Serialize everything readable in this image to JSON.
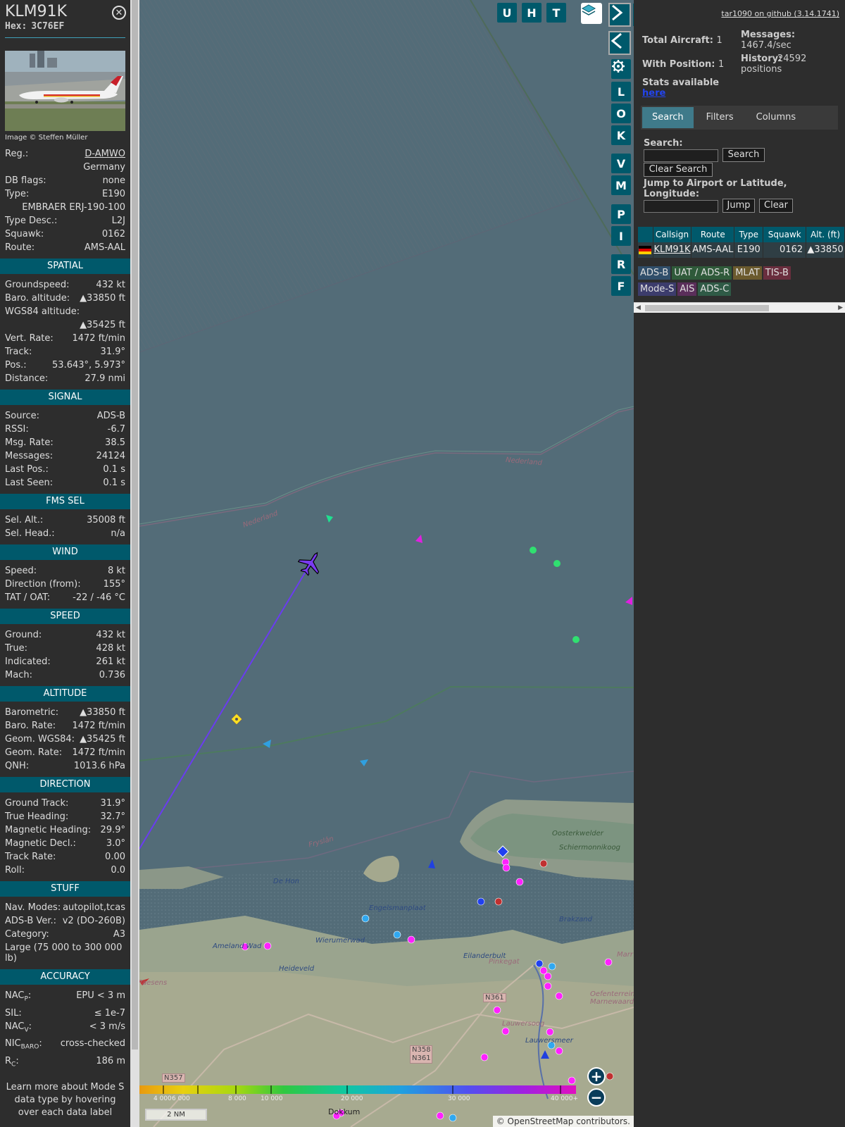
{
  "aircraft": {
    "callsign": "KLM91K",
    "hex_label": "Hex:",
    "hex": "3C76EF",
    "photo_credit": "Image © Steffen Müller"
  },
  "info": [
    {
      "label": "Reg.:",
      "value": "D-AMWO",
      "link": true
    },
    {
      "label": "",
      "value": "Germany"
    },
    {
      "label": "DB flags:",
      "value": "none"
    },
    {
      "label": "Type:",
      "value": "E190"
    },
    {
      "label": "",
      "value": "EMBRAER ERJ-190-100"
    },
    {
      "label": "Type Desc.:",
      "value": "L2J"
    },
    {
      "label": "Squawk:",
      "value": "0162"
    },
    {
      "label": "Route:",
      "value": "AMS-AAL"
    }
  ],
  "sections": [
    {
      "title": "SPATIAL",
      "rows": [
        {
          "label": "Groundspeed:",
          "value": "432 kt"
        },
        {
          "label": "Baro. altitude:",
          "value": "▲33850 ft"
        },
        {
          "label": "WGS84 altitude:",
          "value": ""
        },
        {
          "label": "",
          "value": "▲35425 ft"
        },
        {
          "label": "Vert. Rate:",
          "value": "1472 ft/min"
        },
        {
          "label": "Track:",
          "value": "31.9°"
        },
        {
          "label": "Pos.:",
          "value": "53.643°, 5.973°"
        },
        {
          "label": "Distance:",
          "value": "27.9 nmi"
        }
      ]
    },
    {
      "title": "SIGNAL",
      "rows": [
        {
          "label": "Source:",
          "value": "ADS-B"
        },
        {
          "label": "RSSI:",
          "value": "-6.7"
        },
        {
          "label": "Msg. Rate:",
          "value": "38.5"
        },
        {
          "label": "Messages:",
          "value": "24124"
        },
        {
          "label": "Last Pos.:",
          "value": "0.1 s"
        },
        {
          "label": "Last Seen:",
          "value": "0.1 s"
        }
      ]
    },
    {
      "title": "FMS SEL",
      "rows": [
        {
          "label": "Sel. Alt.:",
          "value": "35008 ft"
        },
        {
          "label": "Sel. Head.:",
          "value": "n/a"
        }
      ]
    },
    {
      "title": "WIND",
      "rows": [
        {
          "label": "Speed:",
          "value": "8 kt"
        },
        {
          "label": "Direction (from):",
          "value": "155°"
        },
        {
          "label": "TAT / OAT:",
          "value": "-22 / -46 °C"
        }
      ]
    },
    {
      "title": "SPEED",
      "rows": [
        {
          "label": "Ground:",
          "value": "432 kt"
        },
        {
          "label": "True:",
          "value": "428 kt"
        },
        {
          "label": "Indicated:",
          "value": "261 kt"
        },
        {
          "label": "Mach:",
          "value": "0.736"
        }
      ]
    },
    {
      "title": "ALTITUDE",
      "rows": [
        {
          "label": "Barometric:",
          "value": "▲33850 ft"
        },
        {
          "label": "Baro. Rate:",
          "value": "1472 ft/min"
        },
        {
          "label": "Geom. WGS84:",
          "value": "▲35425 ft"
        },
        {
          "label": "Geom. Rate:",
          "value": "1472 ft/min"
        },
        {
          "label": "QNH:",
          "value": "1013.6 hPa"
        }
      ]
    },
    {
      "title": "DIRECTION",
      "rows": [
        {
          "label": "Ground Track:",
          "value": "31.9°"
        },
        {
          "label": "True Heading:",
          "value": "32.7°"
        },
        {
          "label": "Magnetic Heading:",
          "value": "29.9°"
        },
        {
          "label": "Magnetic Decl.:",
          "value": "3.0°"
        },
        {
          "label": "Track Rate:",
          "value": "0.00"
        },
        {
          "label": "Roll:",
          "value": "0.0"
        }
      ]
    },
    {
      "title": "STUFF",
      "rows": [
        {
          "label": "Nav. Modes:",
          "value": "autopilot,tcas"
        },
        {
          "label": "ADS-B Ver.:",
          "value": "v2 (DO-260B)"
        },
        {
          "label": "Category:",
          "value": "A3"
        },
        {
          "label": "Large (75 000 to 300 000 lb)",
          "value": "",
          "wrap": true
        }
      ]
    },
    {
      "title": "ACCURACY",
      "rows": [
        {
          "label": "NACP:",
          "value": "EPU < 3 m",
          "sub": "P"
        },
        {
          "label": "SIL:",
          "value": "≤ 1e-7"
        },
        {
          "label": "NACV:",
          "value": "< 3 m/s",
          "sub": "V"
        },
        {
          "label": "NICBARO:",
          "value": "cross-checked",
          "sub": "BARO"
        },
        {
          "label": "RC:",
          "value": "186 m",
          "sub": "C"
        }
      ]
    }
  ],
  "learn_more": "Learn more about Mode S data type by hovering over each data label",
  "map_buttons": {
    "top": [
      "U",
      "H",
      "T"
    ],
    "side": [
      "L",
      "O",
      "K",
      "V",
      "M",
      "P",
      "I",
      "R",
      "F"
    ]
  },
  "map_labels": [
    {
      "text": "Nederland",
      "cls": ""
    },
    {
      "text": "Nederland",
      "cls": ""
    },
    {
      "text": "Oosterkwelder",
      "cls": "g"
    },
    {
      "text": "Schiermonnikoog",
      "cls": "g"
    },
    {
      "text": "De Hon",
      "cls": "b"
    },
    {
      "text": "Engelsmanplaat",
      "cls": "b"
    },
    {
      "text": "Brakzand",
      "cls": "b"
    },
    {
      "text": "Ameland Wad",
      "cls": "b"
    },
    {
      "text": "Wierumerwad",
      "cls": "b"
    },
    {
      "text": "Heideveld",
      "cls": "b"
    },
    {
      "text": "Fryslân",
      "cls": ""
    },
    {
      "text": "Pinkegat",
      "cls": ""
    },
    {
      "text": "Eilanderbult",
      "cls": "b"
    },
    {
      "text": "Lauwersoog",
      "cls": ""
    },
    {
      "text": "Lauwersmeer",
      "cls": "b"
    },
    {
      "text": "Oefenterrein Marnewaard",
      "cls": ""
    },
    {
      "text": "Dokkum",
      "cls": ""
    },
    {
      "text": "Paesens",
      "cls": ""
    },
    {
      "text": "Marr",
      "cls": ""
    }
  ],
  "roads": [
    "N361",
    "N358 N361",
    "N357"
  ],
  "color_bar": {
    "ticks": [
      "4 000",
      "6 000",
      "8 000",
      "10 000",
      "20 000",
      "30 000",
      "40 000+"
    ]
  },
  "scale_label": "2 NM",
  "attribution": "© OpenStreetMap contributors.",
  "right": {
    "github": "tar1090 on github (3.14.1741)",
    "total_aircraft_label": "Total Aircraft:",
    "total_aircraft": "1",
    "with_position_label": "With Position:",
    "with_position": "1",
    "messages_label": "Messages:",
    "messages": "1467.4/sec",
    "history_label": "History:",
    "history": "24592 positions",
    "stats_label": "Stats available",
    "stats_link": "here",
    "tabs": [
      "Search",
      "Filters",
      "Columns"
    ],
    "search_label": "Search:",
    "search_button": "Search",
    "clear_search_button": "Clear Search",
    "jump_label": "Jump to Airport or Latitude, Longitude:",
    "jump_button": "Jump",
    "clear_button": "Clear",
    "table_headers": [
      "Callsign",
      "Route",
      "Type",
      "Squawk",
      "Alt. (ft)"
    ],
    "table_rows": [
      {
        "callsign": "KLM91K",
        "route": "AMS-AAL",
        "type": "E190",
        "squawk": "0162",
        "alt": "▲33850"
      }
    ],
    "legend": [
      {
        "label": "ADS-B",
        "color": "#304e6a"
      },
      {
        "label": "UAT / ADS-R",
        "color": "#2f5a3a"
      },
      {
        "label": "MLAT",
        "color": "#6b5a2e"
      },
      {
        "label": "TIS-B",
        "color": "#6a2e3e"
      },
      {
        "label": "Mode-S",
        "color": "#3c3c6c"
      },
      {
        "label": "AIS",
        "color": "#5a2e5a"
      },
      {
        "label": "ADS-C",
        "color": "#2f5a46"
      }
    ]
  }
}
